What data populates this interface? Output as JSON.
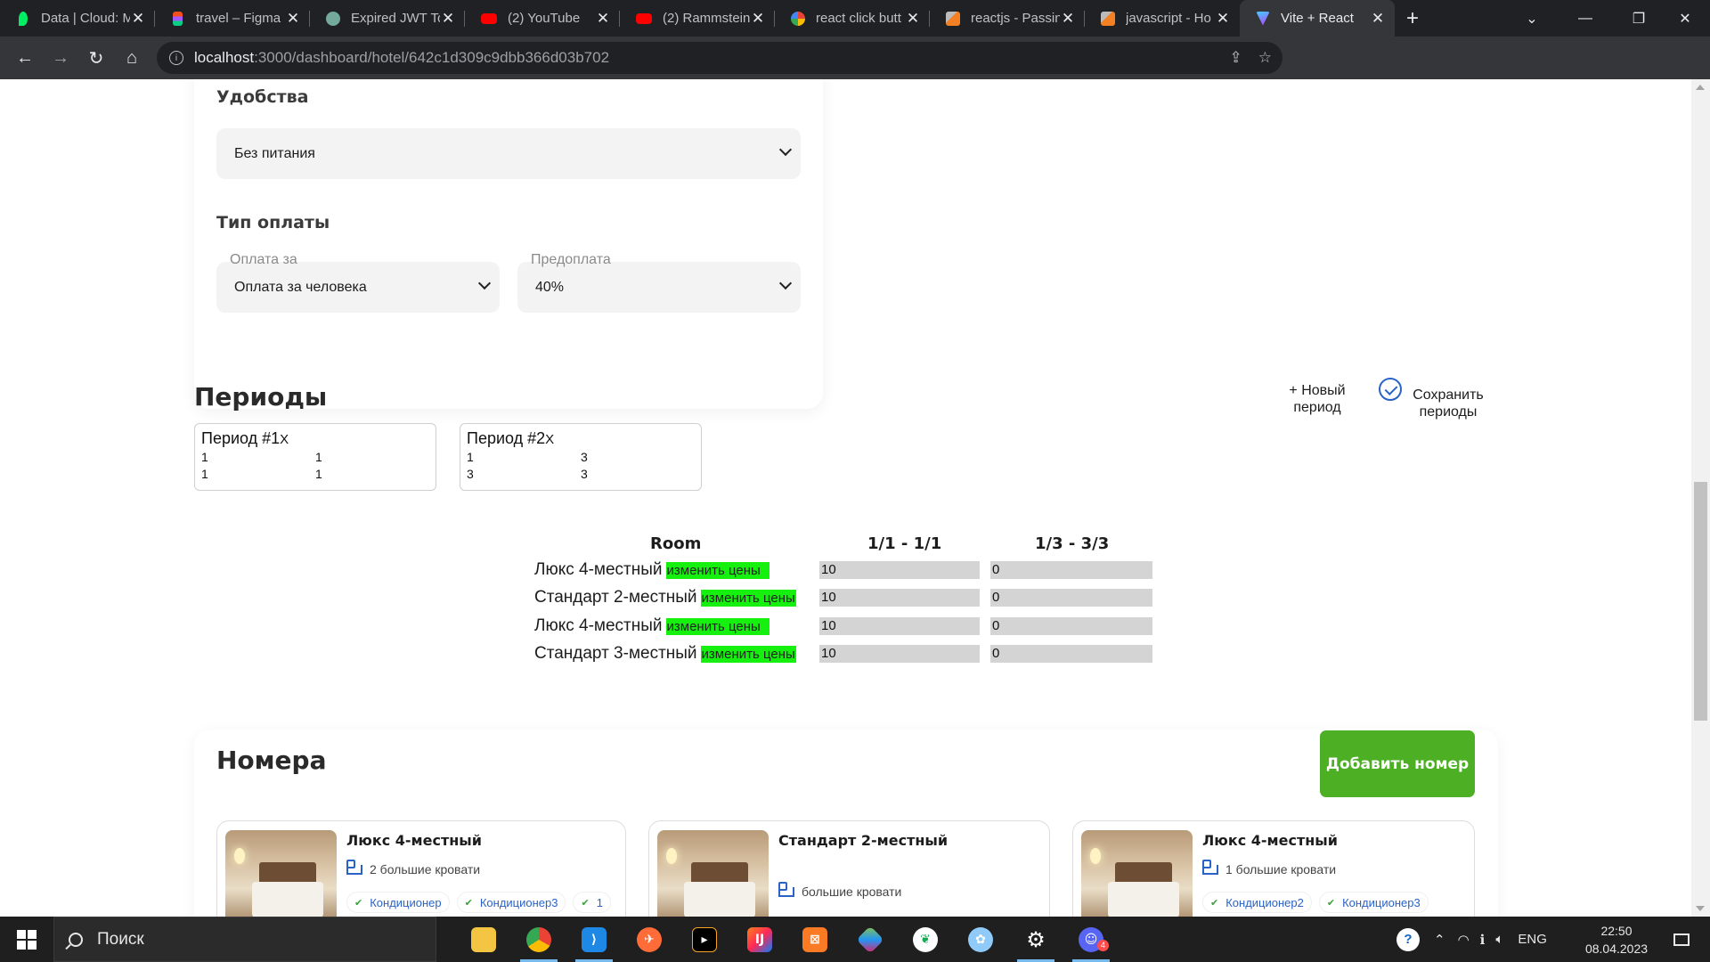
{
  "browser": {
    "tabs": [
      {
        "title": "Data | Cloud: M",
        "icon": "mongodb-leaf-icon",
        "color": "#00ed64"
      },
      {
        "title": "travel – Figma",
        "icon": "figma-icon",
        "color": "#f24e1e"
      },
      {
        "title": "Expired JWT To",
        "icon": "chatgpt-icon",
        "color": "#74aa9c"
      },
      {
        "title": "(2) YouTube",
        "icon": "youtube-icon",
        "color": "#ff0000"
      },
      {
        "title": "(2) Rammstein",
        "icon": "youtube-icon",
        "color": "#ff0000"
      },
      {
        "title": "react click butt",
        "icon": "google-icon",
        "color": "#4285f4"
      },
      {
        "title": "reactjs - Passin",
        "icon": "stackoverflow-icon",
        "color": "#f48024"
      },
      {
        "title": "javascript - Ho",
        "icon": "stackoverflow-icon",
        "color": "#f48024"
      },
      {
        "title": "Vite + React",
        "icon": "vite-icon",
        "color": "#bd34fe"
      }
    ],
    "url_host": "localhost",
    "url_path": ":3000/dashboard/hotel/642c1d309c9dbb366d03b702"
  },
  "hotel_form": {
    "amenities_title": "Удобства",
    "amenities_value": "Без питания",
    "payment_title": "Тип оплаты",
    "pay_for_label": "Оплата за",
    "pay_for_value": "Оплата за человека",
    "prepay_label": "Предоплата",
    "prepay_value": "40%"
  },
  "periods": {
    "title": "Периоды",
    "new_label": "+ Новый период",
    "save_label": "Сохранить периоды",
    "cards": [
      {
        "title": "Период #1",
        "close": "X",
        "rows": [
          [
            "1",
            "1"
          ],
          [
            "1",
            "1"
          ]
        ]
      },
      {
        "title": "Период #2",
        "close": "X",
        "rows": [
          [
            "1",
            "3"
          ],
          [
            "3",
            "3"
          ]
        ]
      }
    ]
  },
  "price_table": {
    "headers": [
      "Room",
      "1/1 - 1/1",
      "1/3 - 3/3"
    ],
    "edit_label": "изменить цены",
    "rows": [
      {
        "room": "Люкс 4-местный",
        "p1": "10",
        "p2": "0"
      },
      {
        "room": "Стандарт 2-местный",
        "p1": "10",
        "p2": "0"
      },
      {
        "room": "Люкс 4-местный",
        "p1": "10",
        "p2": "0"
      },
      {
        "room": "Стандарт 3-местный",
        "p1": "10",
        "p2": "0"
      }
    ]
  },
  "rooms": {
    "title": "Номера",
    "add_label": "Добавить номер",
    "cards": [
      {
        "name": "Люкс 4-местный",
        "beds": "2 большие кровати",
        "tags": [
          "Кондиционер",
          "Кондиционер3",
          "1"
        ]
      },
      {
        "name": "Стандарт 2-местный",
        "beds": "большие кровати",
        "tags": []
      },
      {
        "name": "Люкс 4-местный",
        "beds": "1 большие кровати",
        "tags": [
          "Кондиционер2",
          "Кондиционер3"
        ]
      }
    ]
  },
  "taskbar": {
    "search_placeholder": "Поиск",
    "lang": "ENG",
    "time": "22:50",
    "date": "08.04.2023",
    "notification_count": "4"
  },
  "colors": {
    "accent_green": "#4caf24",
    "highlight_green": "#16f00f",
    "link_blue": "#2a63c7"
  }
}
